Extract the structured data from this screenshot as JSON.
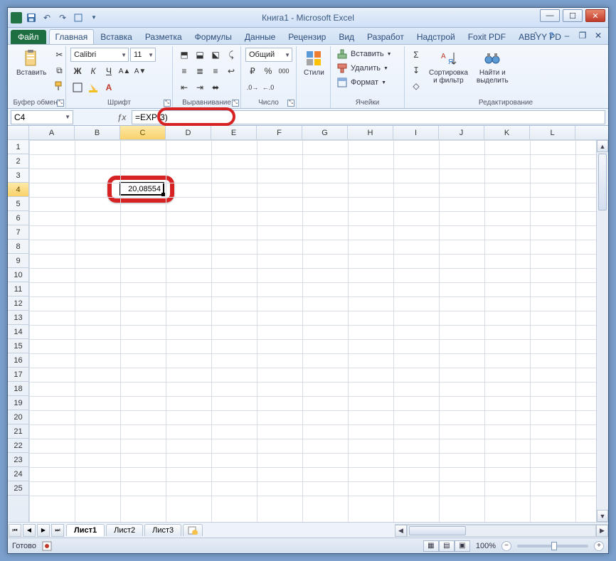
{
  "window": {
    "title": "Книга1  -  Microsoft Excel"
  },
  "qat": {
    "tips": [
      "save",
      "undo",
      "redo",
      "print",
      "open"
    ]
  },
  "tabs": {
    "file": "Файл",
    "items": [
      "Главная",
      "Вставка",
      "Разметка",
      "Формулы",
      "Данные",
      "Рецензир",
      "Вид",
      "Разработ",
      "Надстрой",
      "Foxit PDF",
      "ABBYY PD"
    ],
    "active_index": 0
  },
  "ribbon": {
    "clipboard": {
      "paste": "Вставить",
      "label": "Буфер обмена"
    },
    "font": {
      "name": "Calibri",
      "size": "11",
      "label": "Шрифт",
      "btns_top": [
        "Ж",
        "К",
        "Ч"
      ],
      "btns_bot": [
        "border",
        "fill",
        "font-color"
      ]
    },
    "alignment": {
      "label": "Выравнивание"
    },
    "number": {
      "format": "Общий",
      "label": "Число"
    },
    "styles": {
      "btn": "Стили",
      "label": ""
    },
    "cells": {
      "insert": "Вставить",
      "delete": "Удалить",
      "format": "Формат",
      "label": "Ячейки"
    },
    "editing": {
      "sort": "Сортировка\nи фильтр",
      "find": "Найти и\nвыделить",
      "label": "Редактирование"
    }
  },
  "namebox": {
    "value": "C4"
  },
  "formula": {
    "value": "=EXP(3)"
  },
  "grid": {
    "columns": [
      "A",
      "B",
      "C",
      "D",
      "E",
      "F",
      "G",
      "H",
      "I",
      "J",
      "K",
      "L"
    ],
    "rows": 25,
    "active": {
      "col": "C",
      "row": 4,
      "col_index": 2,
      "display": "20,08554"
    }
  },
  "sheets": {
    "items": [
      "Лист1",
      "Лист2",
      "Лист3"
    ],
    "active_index": 0
  },
  "status": {
    "ready": "Готово",
    "zoom": "100%"
  }
}
